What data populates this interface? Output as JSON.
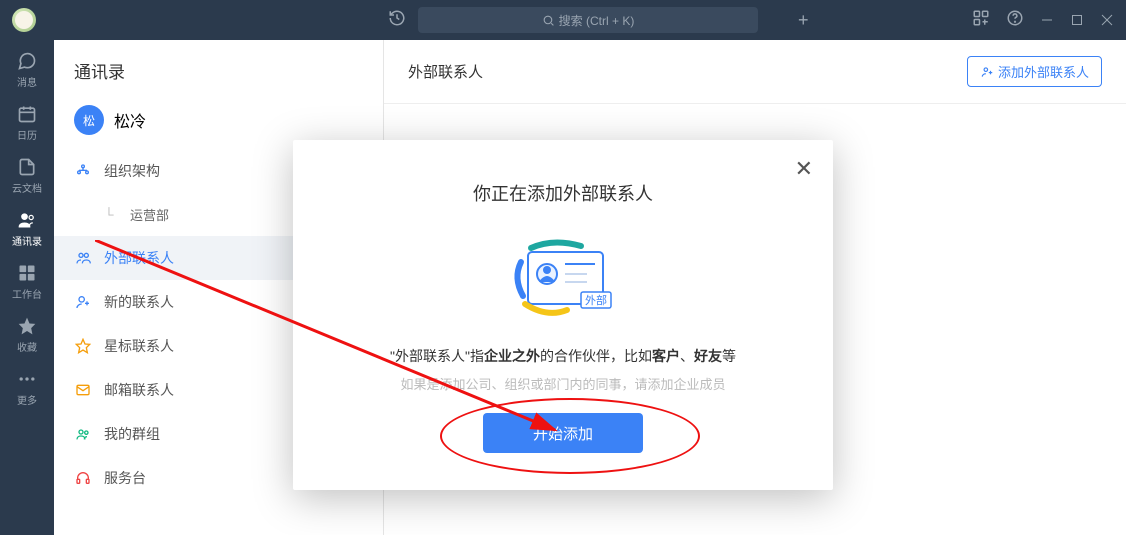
{
  "titlebar": {
    "search_placeholder": "搜索 (Ctrl + K)"
  },
  "nav": {
    "items": [
      {
        "label": "消息"
      },
      {
        "label": "日历"
      },
      {
        "label": "云文档"
      },
      {
        "label": "通讯录"
      },
      {
        "label": "工作台"
      },
      {
        "label": "收藏"
      },
      {
        "label": "更多"
      }
    ]
  },
  "sidebar": {
    "title": "通讯录",
    "user": {
      "avatar_text": "松",
      "name": "松冷"
    },
    "items": [
      {
        "label": "组织架构"
      },
      {
        "label": "运营部"
      },
      {
        "label": "外部联系人"
      },
      {
        "label": "新的联系人"
      },
      {
        "label": "星标联系人"
      },
      {
        "label": "邮箱联系人"
      },
      {
        "label": "我的群组"
      },
      {
        "label": "服务台"
      }
    ]
  },
  "main": {
    "title": "外部联系人",
    "add_button": "添加外部联系人"
  },
  "modal": {
    "title": "你正在添加外部联系人",
    "badge": "外部",
    "desc_prefix": "\"外部联系人\"指",
    "desc_bold1": "企业之外",
    "desc_mid": "的合作伙伴，比如",
    "desc_bold2": "客户",
    "desc_sep": "、",
    "desc_bold3": "好友",
    "desc_suffix": "等",
    "desc2": "如果是添加公司、组织或部门内的同事，请添加企业成员",
    "start_button": "开始添加"
  }
}
